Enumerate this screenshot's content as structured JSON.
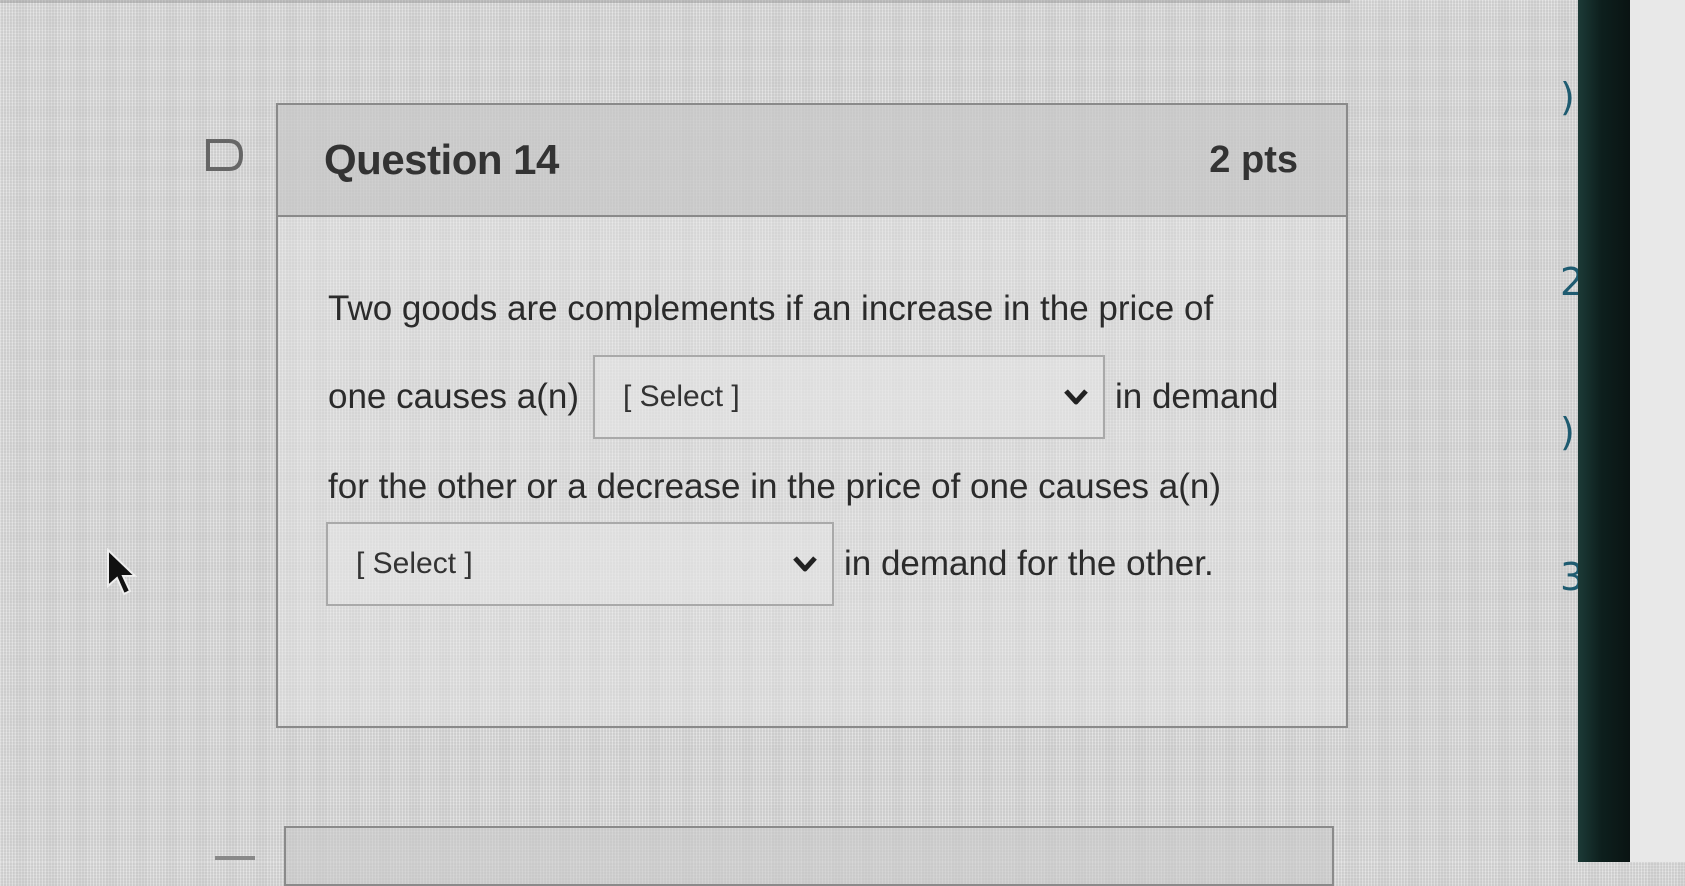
{
  "question": {
    "title": "Question 14",
    "points": "2 pts",
    "text": {
      "line1": "Two goods are complements if an increase in the price of",
      "line2_before": "one causes a(n)",
      "line2_after": "in demand",
      "line3": "for the other or a decrease in the price of one causes a(n)",
      "line4_after": "in demand for the other."
    },
    "dropdowns": [
      {
        "selected": "[ Select ]"
      },
      {
        "selected": "[ Select ]"
      }
    ]
  },
  "icons": {
    "flag": "flag-icon",
    "dropdown": "chevron-down-icon",
    "cursor": "mouse-cursor-icon"
  },
  "colors": {
    "header_bg": "#bebebe",
    "border": "#8a8a8a",
    "text": "#2b2b2b",
    "bezel": "#0d1f1d"
  }
}
